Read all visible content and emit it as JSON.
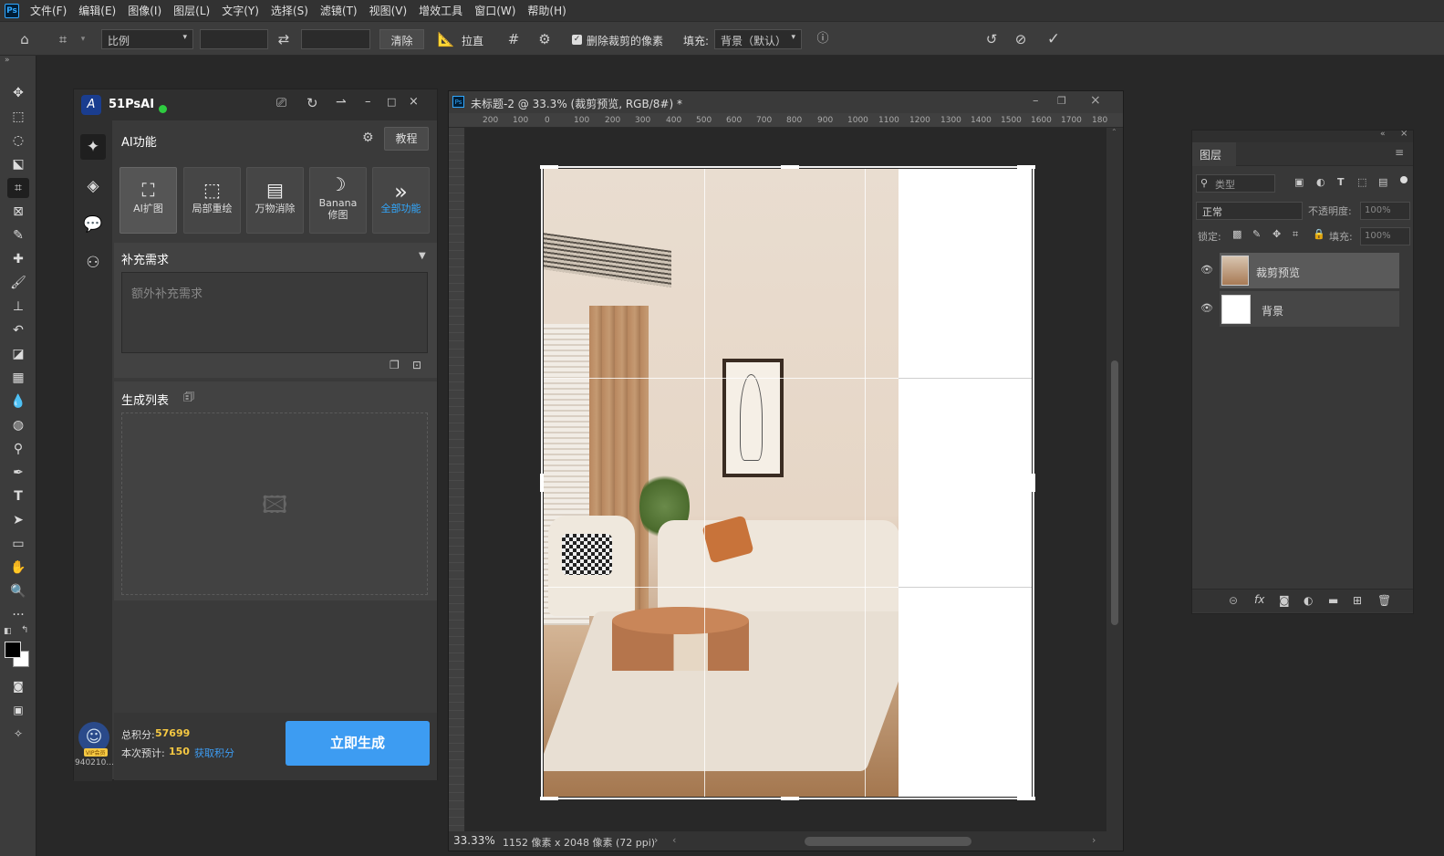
{
  "menubar": {
    "logo": "Ps",
    "items": [
      "文件(F)",
      "编辑(E)",
      "图像(I)",
      "图层(L)",
      "文字(Y)",
      "选择(S)",
      "滤镜(T)",
      "视图(V)",
      "增效工具",
      "窗口(W)",
      "帮助(H)"
    ]
  },
  "options": {
    "ratio_select": "比例",
    "clear_button": "清除",
    "straighten_label": "拉直",
    "delete_pixels_label": "删除裁剪的像素",
    "fill_label": "填充:",
    "fill_value": "背景（默认）"
  },
  "ai_panel": {
    "title": "51PsAI",
    "section_title": "AI功能",
    "tutorial_button": "教程",
    "features": [
      "AI扩图",
      "局部重绘",
      "万物消除",
      "Banana修图",
      "全部功能"
    ],
    "requirement_title": "补充需求",
    "requirement_placeholder": "额外补充需求",
    "generate_list_title": "生成列表",
    "points_label": "总积分:",
    "points_value": "57699",
    "estimate_label": "本次预计:",
    "estimate_value": "150",
    "get_points_link": "获取积分",
    "generate_button": "立即生成",
    "user_id": "940210...",
    "vip_badge": "VIP会员"
  },
  "document": {
    "tab_title": "未标题-2 @ 33.3% (裁剪预览, RGB/8#) *",
    "ruler_ticks": [
      "200",
      "100",
      "0",
      "100",
      "200",
      "300",
      "400",
      "500",
      "600",
      "700",
      "800",
      "900",
      "1000",
      "1100",
      "1200",
      "1300",
      "1400",
      "1500",
      "1600",
      "1700",
      "180"
    ],
    "zoom": "33.33%",
    "dimensions": "1152 像素 x 2048 像素 (72 ppi)"
  },
  "layers_panel": {
    "title": "图层",
    "search_placeholder": "类型",
    "blend_mode": "正常",
    "opacity_label": "不透明度:",
    "opacity_value": "100%",
    "lock_label": "锁定:",
    "fill_label": "填充:",
    "fill_value": "100%",
    "layers": [
      {
        "name": "裁剪预览",
        "selected": true
      },
      {
        "name": "背景",
        "selected": false
      }
    ]
  },
  "colors": {
    "accent": "#31a8ff",
    "generate_button": "#3d9cf2",
    "points_value": "#f5c842",
    "status_dot": "#2ecc40"
  }
}
